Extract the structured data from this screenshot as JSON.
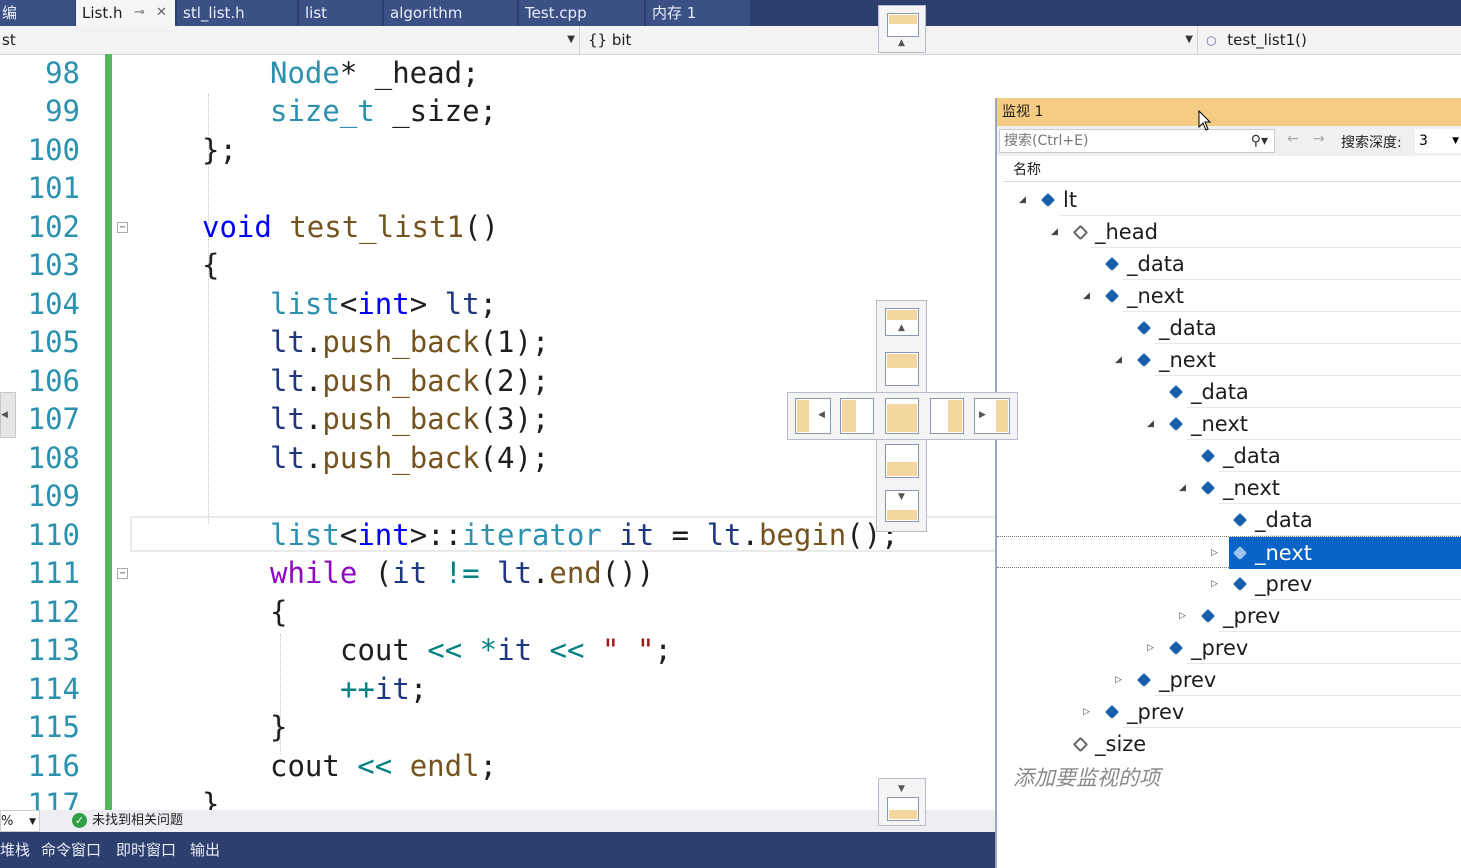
{
  "tabs": [
    {
      "label": "编"
    },
    {
      "label": "List.h",
      "active": true
    },
    {
      "label": "stl_list.h"
    },
    {
      "label": "list"
    },
    {
      "label": "algorithm"
    },
    {
      "label": "Test.cpp"
    },
    {
      "label": "内存 1"
    }
  ],
  "navbar": {
    "project": "st",
    "scope": "{} bit",
    "member": "test_list1()"
  },
  "code_lines": [
    {
      "num": "98"
    },
    {
      "num": "99"
    },
    {
      "num": "100"
    },
    {
      "num": "101"
    },
    {
      "num": "102"
    },
    {
      "num": "103"
    },
    {
      "num": "104"
    },
    {
      "num": "105"
    },
    {
      "num": "106"
    },
    {
      "num": "107"
    },
    {
      "num": "108"
    },
    {
      "num": "109"
    },
    {
      "num": "110"
    },
    {
      "num": "111"
    },
    {
      "num": "112"
    },
    {
      "num": "113"
    },
    {
      "num": "114"
    },
    {
      "num": "115"
    },
    {
      "num": "116"
    },
    {
      "num": "117"
    }
  ],
  "code_text": {
    "l98": [
      "Node",
      "* _head;"
    ],
    "l99": [
      "size_t",
      " _size;"
    ],
    "l100": "};",
    "l102": [
      "void",
      " ",
      "test_list1",
      "()"
    ],
    "l103": "{",
    "l104": [
      "list",
      "<",
      "int",
      "> ",
      "lt",
      ";"
    ],
    "l105": [
      "lt",
      ".",
      "push_back",
      "(1);"
    ],
    "l106": [
      "lt",
      ".",
      "push_back",
      "(2);"
    ],
    "l107": [
      "lt",
      ".",
      "push_back",
      "(3);"
    ],
    "l108": [
      "lt",
      ".",
      "push_back",
      "(4);"
    ],
    "l110": [
      "list",
      "<",
      "int",
      ">::",
      "iterator",
      " ",
      "it",
      " = ",
      "lt",
      ".",
      "begin",
      "();"
    ],
    "l111": [
      "while",
      " (",
      "it",
      " != ",
      "lt",
      ".",
      "end",
      "())"
    ],
    "l112": "{",
    "l113": [
      "cout",
      " << *",
      "it",
      " << ",
      "\" \"",
      ";"
    ],
    "l114": [
      "++",
      "it",
      ";"
    ],
    "l115": "}",
    "l116": [
      "cout",
      " << ",
      "endl",
      ";"
    ],
    "l117": "}"
  },
  "status": {
    "zoom": "%",
    "issues": "未找到相关问题"
  },
  "bottom_tabs": [
    "堆栈",
    "命令窗口",
    "即时窗口",
    "输出"
  ],
  "watch": {
    "title": "监视 1",
    "search_placeholder": "搜索(Ctrl+E)",
    "depth_label": "搜索深度:",
    "depth_value": "3",
    "column_name": "名称",
    "add_hint": "添加要监视的项",
    "rows": [
      {
        "name": "lt"
      },
      {
        "name": "_head"
      },
      {
        "name": "_data"
      },
      {
        "name": "_next"
      },
      {
        "name": "_data"
      },
      {
        "name": "_next"
      },
      {
        "name": "_data"
      },
      {
        "name": "_next"
      },
      {
        "name": "_data"
      },
      {
        "name": "_next"
      },
      {
        "name": "_data"
      },
      {
        "name": "_next"
      },
      {
        "name": "_prev"
      },
      {
        "name": "_prev"
      },
      {
        "name": "_prev"
      },
      {
        "name": "_prev"
      },
      {
        "name": "_prev"
      },
      {
        "name": "_size"
      }
    ]
  },
  "colors": {
    "accent": "#0a64c8",
    "tabbar": "#2d3f6e",
    "watch_title": "#f5cc84",
    "change_bar": "#57b55b"
  }
}
